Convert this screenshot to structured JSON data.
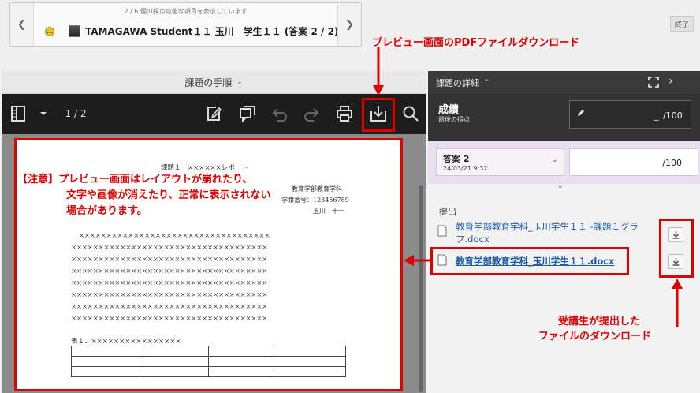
{
  "navigator": {
    "count_text": "2 / 6 個の採点可能な項目を表示しています",
    "student_text": "TAMAGAWA Student１１ 玉川　学生１１ (答案 2 / 2)",
    "status_glyph": "…",
    "prev_icon": "chevron-left-icon",
    "next_icon": "chevron-right-icon"
  },
  "end_button": "終了",
  "left_panel": {
    "title": "課題の手順",
    "page_indicator": "1 / 2"
  },
  "document": {
    "heading": "課題１　××××××レポート",
    "faculty": "教育学部教育学科",
    "student_number": "学籍番号：123456789",
    "author": "玉川　十一",
    "x_lines": [
      "×××××××××××××××××××××××××××××××××××",
      "××××××××××××××××××××××××××××××××××××",
      "××××××××××××××××××××××××××××××××××××",
      "××××××××××××××××××××××××××××××××××××",
      "××××××××××××××××××××××××××××××××××××",
      "××××××××××××××××××××××××××××××××××××",
      "××××××××××××××××××××××××××××××××××××",
      "××××××××××××××××××××××××××××××××××××"
    ],
    "table_caption": "表１．××××××××××××××××",
    "table_rows": 3,
    "table_cols": 4
  },
  "right_panel": {
    "title": "課題の詳細",
    "grade_title": "成績",
    "grade_subtitle": "最後の得点",
    "grade_value": "_",
    "grade_max": "/100",
    "attempt_label": "答案 2",
    "attempt_date": "24/03/21 9:32",
    "attempt_max": "/100",
    "submission_label": "提出",
    "files": [
      {
        "name": "教育学部教育学科_玉川学生１１ -課題１グラフ.docx",
        "line1": "教育学部教育学科_玉川学生１１ -課題１グラ",
        "line2": "フ.docx"
      },
      {
        "name": "教育学部教育学科_玉川学生１１.docx"
      }
    ]
  },
  "annotations": {
    "pdf_download": "プレビュー画面のPDFファイルダウンロード",
    "note_line1": "【注意】プレビュー画面はレイアウトが崩れたり、",
    "note_line2": "文字や画像が消えたり、正常に表示されない",
    "note_line3": "場合があります。",
    "student_download_line1": "受講生が提出した",
    "student_download_line2": "ファイルのダウンロード"
  },
  "colors": {
    "annotation_red": "#e00000",
    "toolbar_bg": "#1d1d1d",
    "link_blue": "#1c5aa6",
    "attempt_bg": "#eadff0"
  }
}
